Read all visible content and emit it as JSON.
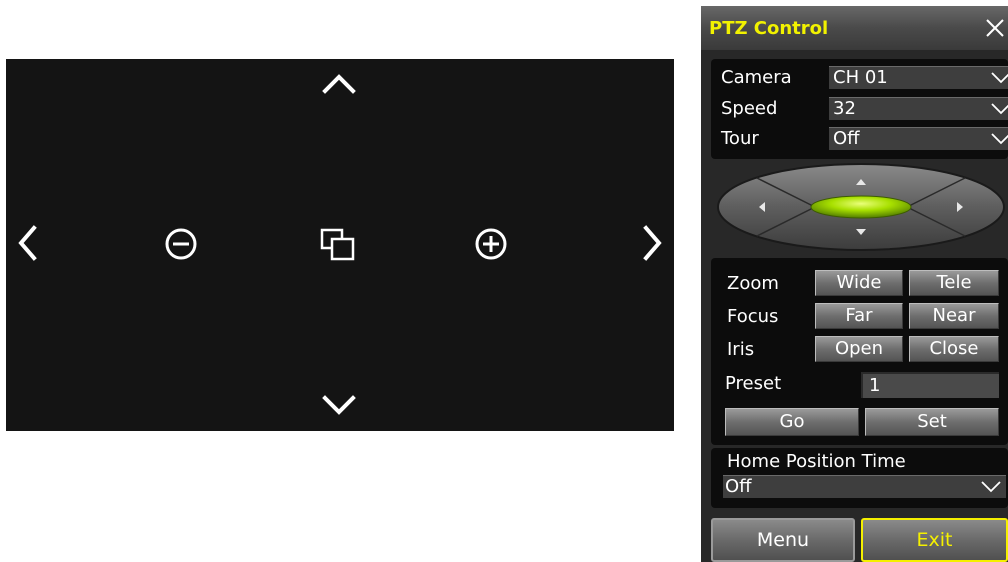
{
  "video": {
    "controls": [
      "up-arrow-icon",
      "down-arrow-icon",
      "left-arrow-icon",
      "right-arrow-icon",
      "zoom-out-icon",
      "fullscreen-icon",
      "zoom-in-icon"
    ]
  },
  "panel": {
    "title": "PTZ Control",
    "camera_label": "Camera",
    "camera_value": "CH 01",
    "speed_label": "Speed",
    "speed_value": "32",
    "tour_label": "Tour",
    "tour_value": "Off",
    "zoom_label": "Zoom",
    "zoom_wide": "Wide",
    "zoom_tele": "Tele",
    "focus_label": "Focus",
    "focus_far": "Far",
    "focus_near": "Near",
    "iris_label": "Iris",
    "iris_open": "Open",
    "iris_close": "Close",
    "preset_label": "Preset",
    "preset_value": "1",
    "go_label": "Go",
    "set_label": "Set",
    "home_label": "Home Position Time",
    "home_value": "Off",
    "menu_label": "Menu",
    "exit_label": "Exit"
  },
  "colors": {
    "title": "#f2f200",
    "accent_active": "#f5f000",
    "joystick_center": "#a8e000",
    "video_bg": "#141414"
  }
}
